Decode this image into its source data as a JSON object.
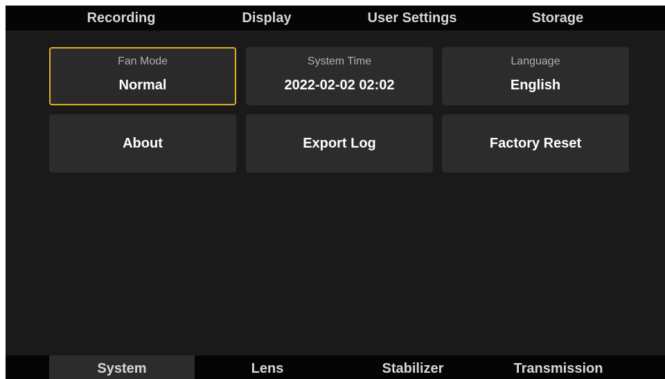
{
  "top_nav": {
    "tabs": [
      {
        "label": "Recording"
      },
      {
        "label": "Display"
      },
      {
        "label": "User Settings"
      },
      {
        "label": "Storage"
      }
    ]
  },
  "settings": {
    "fan_mode": {
      "caption": "Fan Mode",
      "value": "Normal",
      "selected": true
    },
    "system_time": {
      "caption": "System Time",
      "value": "2022-02-02 02:02"
    },
    "language": {
      "caption": "Language",
      "value": "English"
    },
    "about": {
      "label": "About"
    },
    "export_log": {
      "label": "Export Log"
    },
    "factory_reset": {
      "label": "Factory Reset"
    }
  },
  "bottom_nav": {
    "active": "System",
    "tabs": [
      {
        "label": "System"
      },
      {
        "label": "Lens"
      },
      {
        "label": "Stabilizer"
      },
      {
        "label": "Transmission"
      }
    ]
  },
  "colors": {
    "background": "#1a1a1a",
    "tile": "#2c2c2c",
    "nav_bar": "#050505",
    "selection_border": "#e0b020",
    "text_primary": "#ffffff",
    "text_secondary": "#b0b0b0"
  }
}
